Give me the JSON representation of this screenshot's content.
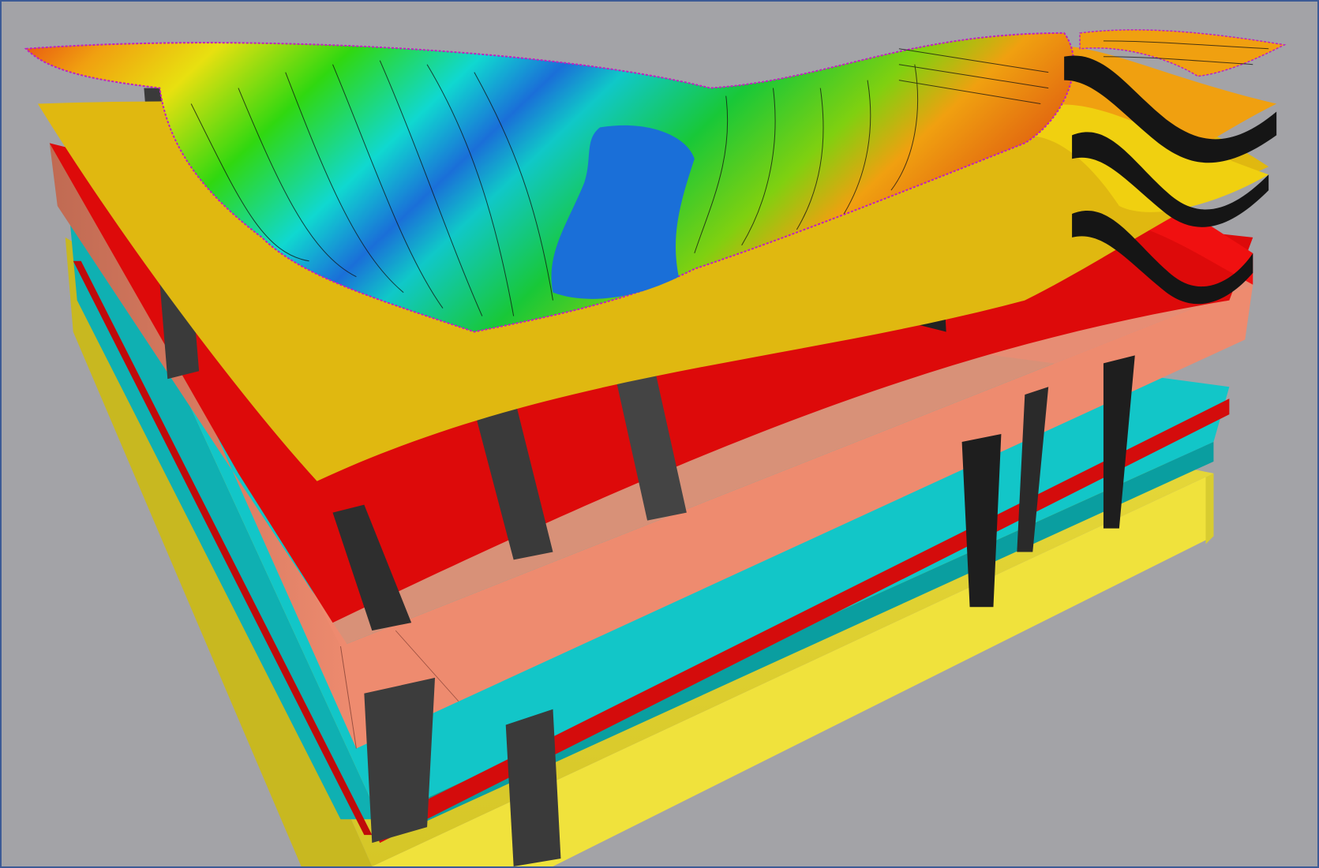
{
  "scene": {
    "background_color": "#a3a3a7",
    "frame_color": "#3c5a96",
    "layers": [
      {
        "name": "bottom-yellow-layer",
        "color": "#f0e23c"
      },
      {
        "name": "cyan-layer",
        "color": "#12c6c8"
      },
      {
        "name": "thin-red-layer",
        "color": "#d40c0c"
      },
      {
        "name": "salmon-layer",
        "color": "#ee8b6f"
      },
      {
        "name": "red-layer",
        "color": "#dd0a0a"
      },
      {
        "name": "yellow-layer",
        "color": "#e0b810"
      },
      {
        "name": "top-surface",
        "color_scale": [
          "#1a6fd8",
          "#10d8d8",
          "#18d818",
          "#e8e810",
          "#f08010",
          "#e82808"
        ]
      }
    ],
    "fault_color": "#3a3a3a",
    "boundary_color": "#d020d0"
  }
}
